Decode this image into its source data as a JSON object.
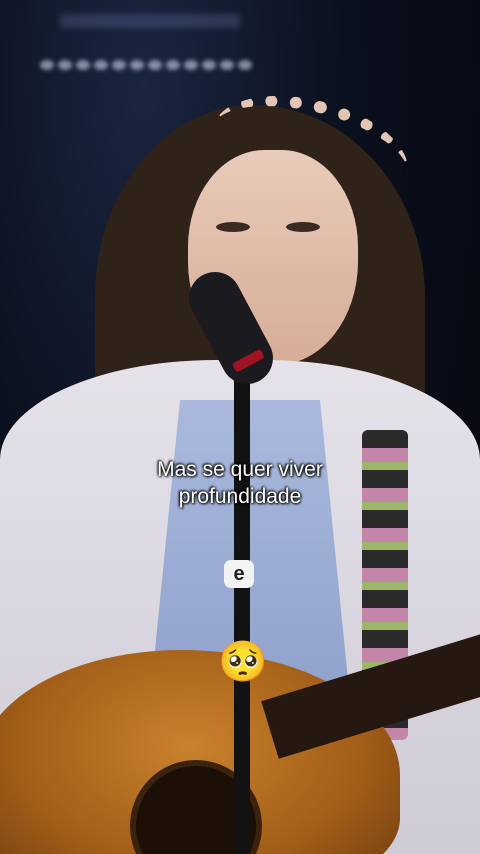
{
  "caption": {
    "line1": "Mas se quer viver",
    "line2": "profundidade"
  },
  "watermark": {
    "icon": "e-logo-icon",
    "glyph": "e"
  },
  "emoji": {
    "icon": "pleading-face-emoji",
    "glyph": "🥺"
  }
}
